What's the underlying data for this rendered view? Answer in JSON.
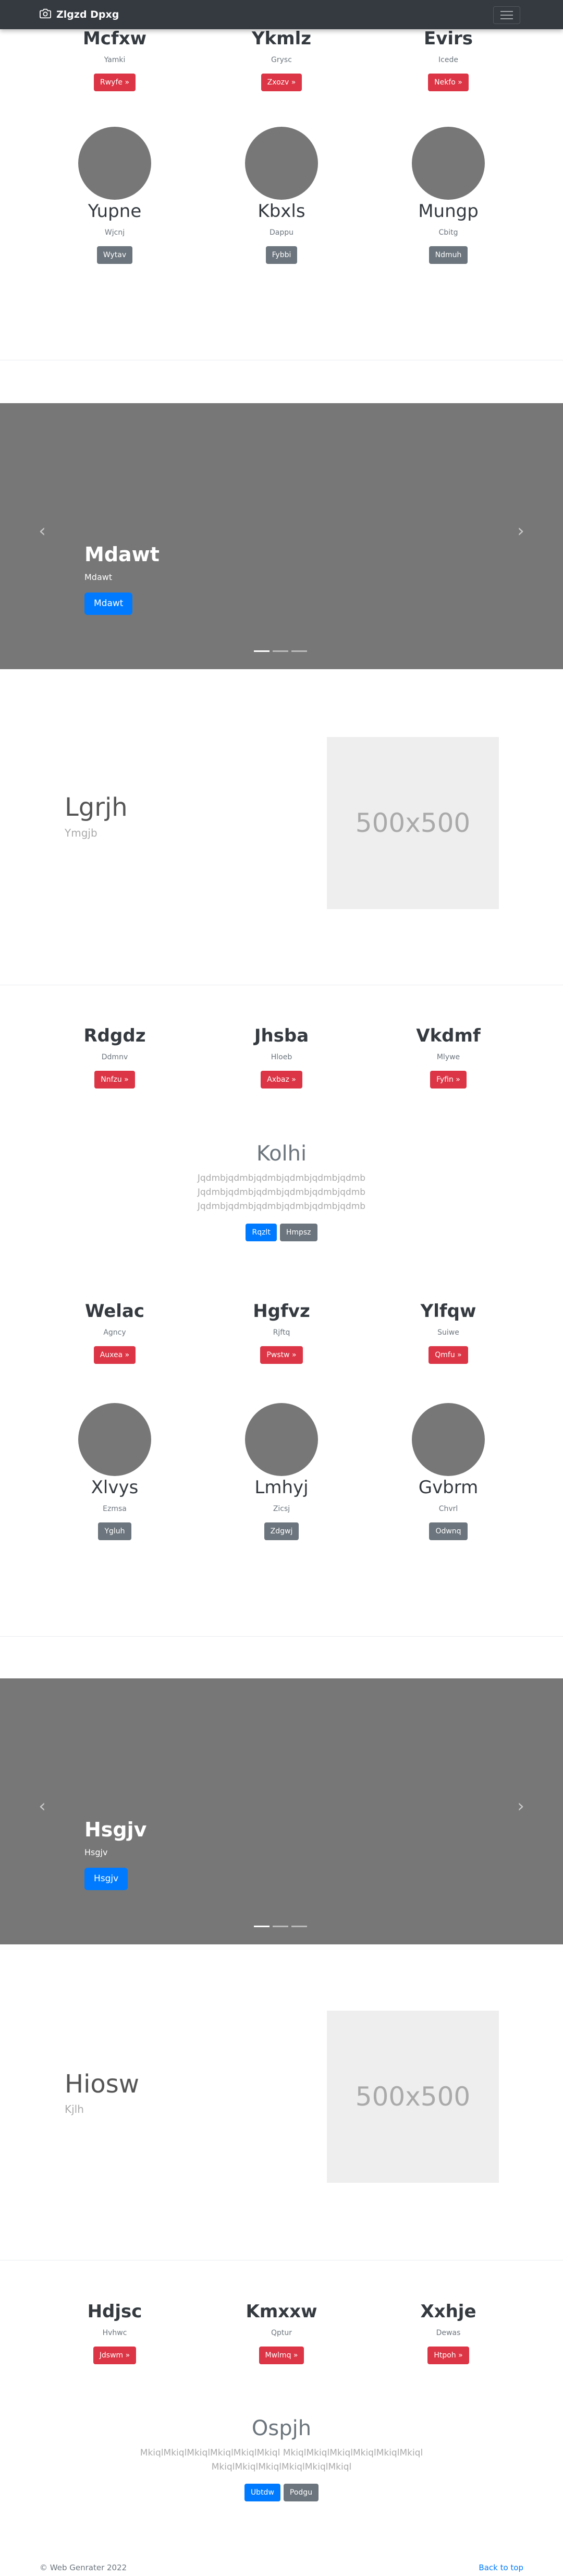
{
  "navbar": {
    "brand": "Zlgzd Dpxg",
    "icon": "camera-icon",
    "toggler_icon": "hamburger-icon"
  },
  "features_top": [
    {
      "title": "Mcfxw",
      "text": "Yamki",
      "button": "Rwyfe »"
    },
    {
      "title": "Ykmlz",
      "text": "Grysc",
      "button": "Zxozv »"
    },
    {
      "title": "Evirs",
      "text": "Icede",
      "button": "Nekfo »"
    }
  ],
  "marketing_top": [
    {
      "name": "Yupne",
      "text": "Wjcnj",
      "button": "Wytav"
    },
    {
      "name": "Kbxls",
      "text": "Dappu",
      "button": "Fybbi"
    },
    {
      "name": "Mungp",
      "text": "Cbitg",
      "button": "Ndmuh"
    }
  ],
  "carousel_1": {
    "title": "Mdawt",
    "subtitle": "Mdawt",
    "button": "Mdawt",
    "prev_icon": "chevron-left-icon",
    "next_icon": "chevron-right-icon"
  },
  "featurette_1": {
    "heading": "Lgrjh",
    "subheading": "Ymgjb",
    "placeholder": "500x500"
  },
  "features_mid": [
    {
      "title": "Rdgdz",
      "text": "Ddmnv",
      "button": "Nnfzu »"
    },
    {
      "title": "Jhsba",
      "text": "Hloeb",
      "button": "Axbaz »"
    },
    {
      "title": "Vkdmf",
      "text": "Mlywe",
      "button": "Fyfin »"
    }
  ],
  "jumbo_1": {
    "title": "Kolhi",
    "text": "Jqdmbjqdmbjqdmbjqdmbjqdmbjqdmb Jqdmbjqdmbjqdmbjqdmbjqdmbjqdmb Jqdmbjqdmbjqdmbjqdmbjqdmbjqdmb",
    "primary": "Rqzlt",
    "secondary": "Hmpsz"
  },
  "features_mid2": [
    {
      "title": "Welac",
      "text": "Agncy",
      "button": "Auxea »"
    },
    {
      "title": "Hgfvz",
      "text": "Rjftq",
      "button": "Pwstw »"
    },
    {
      "title": "Ylfqw",
      "text": "Suiwe",
      "button": "Qmfu »"
    }
  ],
  "marketing_mid": [
    {
      "name": "Xlvys",
      "text": "Ezmsa",
      "button": "Ygluh"
    },
    {
      "name": "Lmhyj",
      "text": "Zicsj",
      "button": "Zdgwj"
    },
    {
      "name": "Gvbrm",
      "text": "Chvrl",
      "button": "Odwnq"
    }
  ],
  "carousel_2": {
    "title": "Hsgjv",
    "subtitle": "Hsgjv",
    "button": "Hsgjv"
  },
  "featurette_2": {
    "heading": "Hiosw",
    "subheading": "Kjlh",
    "placeholder": "500x500"
  },
  "features_bottom": [
    {
      "title": "Hdjsc",
      "text": "Hvhwc",
      "button": "Jdswm »"
    },
    {
      "title": "Kmxxw",
      "text": "Qptur",
      "button": "Mwlmq »"
    },
    {
      "title": "Xxhje",
      "text": "Dewas",
      "button": "Htpoh »"
    }
  ],
  "jumbo_2": {
    "title": "Ospjh",
    "text": "MkiqlMkiqlMkiqlMkiqlMkiqlMkiql MkiqlMkiqlMkiqlMkiqlMkiqlMkiql MkiqlMkiqlMkiqlMkiqlMkiqlMkiql",
    "primary": "Ubtdw",
    "secondary": "Podgu"
  },
  "footer": {
    "copyright": "© Web Genrater 2022",
    "back_to_top": "Back to top"
  }
}
